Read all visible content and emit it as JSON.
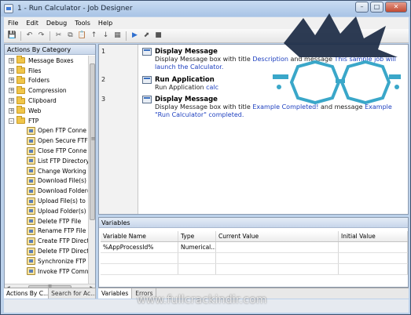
{
  "window": {
    "title": "1 - Run Calculator - Job Designer",
    "minimize": "–",
    "maximize": "□",
    "close": "✕"
  },
  "menu": [
    "File",
    "Edit",
    "Debug",
    "Tools",
    "Help"
  ],
  "toolbar": {
    "icons": [
      "save-icon",
      "undo-icon",
      "redo-icon",
      "cut-icon",
      "copy-icon",
      "paste-icon",
      "move-up-icon",
      "move-down-icon",
      "properties-icon",
      "run-icon",
      "debug-icon",
      "stop-icon"
    ],
    "glyphs": [
      "💾",
      "↶",
      "↷",
      "✂",
      "⧉",
      "📋",
      "↑",
      "↓",
      "▦",
      "▶",
      "⬈",
      "■"
    ]
  },
  "left_panel": {
    "header": "Actions By Category",
    "categories": [
      {
        "label": "Message Boxes",
        "expander": "+"
      },
      {
        "label": "Files",
        "expander": "+"
      },
      {
        "label": "Folders",
        "expander": "+"
      },
      {
        "label": "Compression",
        "expander": "+"
      },
      {
        "label": "Clipboard",
        "expander": "+"
      },
      {
        "label": "Web",
        "expander": "+"
      },
      {
        "label": "FTP",
        "expander": "–"
      }
    ],
    "ftp_actions": [
      "Open FTP Conne",
      "Open Secure FTF",
      "Close FTP Conne",
      "List FTP Directory",
      "Change Working",
      "Download File(s) f",
      "Download Folder(",
      "Upload File(s) to F",
      "Upload Folder(s) t",
      "Delete FTP File",
      "Rename FTP File",
      "Create FTP Direct",
      "Delete FTP Direct",
      "Synchronize FTP",
      "Invoke FTP Comn"
    ],
    "scroll_glyph": "≡",
    "hscroll_left": "◀",
    "hscroll_right": "▶",
    "hscroll_grip": "III",
    "tabs": [
      "Actions By C...",
      "Search for Ac..."
    ]
  },
  "script": {
    "steps": [
      {
        "line": "1",
        "title": "Display Message",
        "desc_prefix": "Display Message box with title ",
        "desc_title_value": "Description",
        "desc_middle": " and message ",
        "desc_message_value": "This sample job will launch the Calculator."
      },
      {
        "line": "2",
        "title": "Run Application",
        "desc_prefix": "Run Application ",
        "desc_app_value": "calc"
      },
      {
        "line": "3",
        "title": "Display Message",
        "desc_prefix": "Display Message box with title ",
        "desc_title_value": "Example Completed!",
        "desc_middle": " and message ",
        "desc_message_value": "Example \"Run Calculator\" completed."
      }
    ]
  },
  "variables": {
    "header": "Variables",
    "columns": [
      "Variable Name",
      "Type",
      "Current Value",
      "Initial Value"
    ],
    "rows": [
      {
        "name": "%AppProcessId%",
        "type": "Numerical...",
        "current": "",
        "initial": ""
      }
    ],
    "tabs": [
      "Variables",
      "Errors"
    ]
  },
  "watermark": {
    "text": "www.fullcrackindir.com"
  },
  "colors": {
    "link_blue": "#1d3fbf",
    "logo_cyan": "#3aa7c9",
    "logo_dark": "#1b2a44"
  }
}
